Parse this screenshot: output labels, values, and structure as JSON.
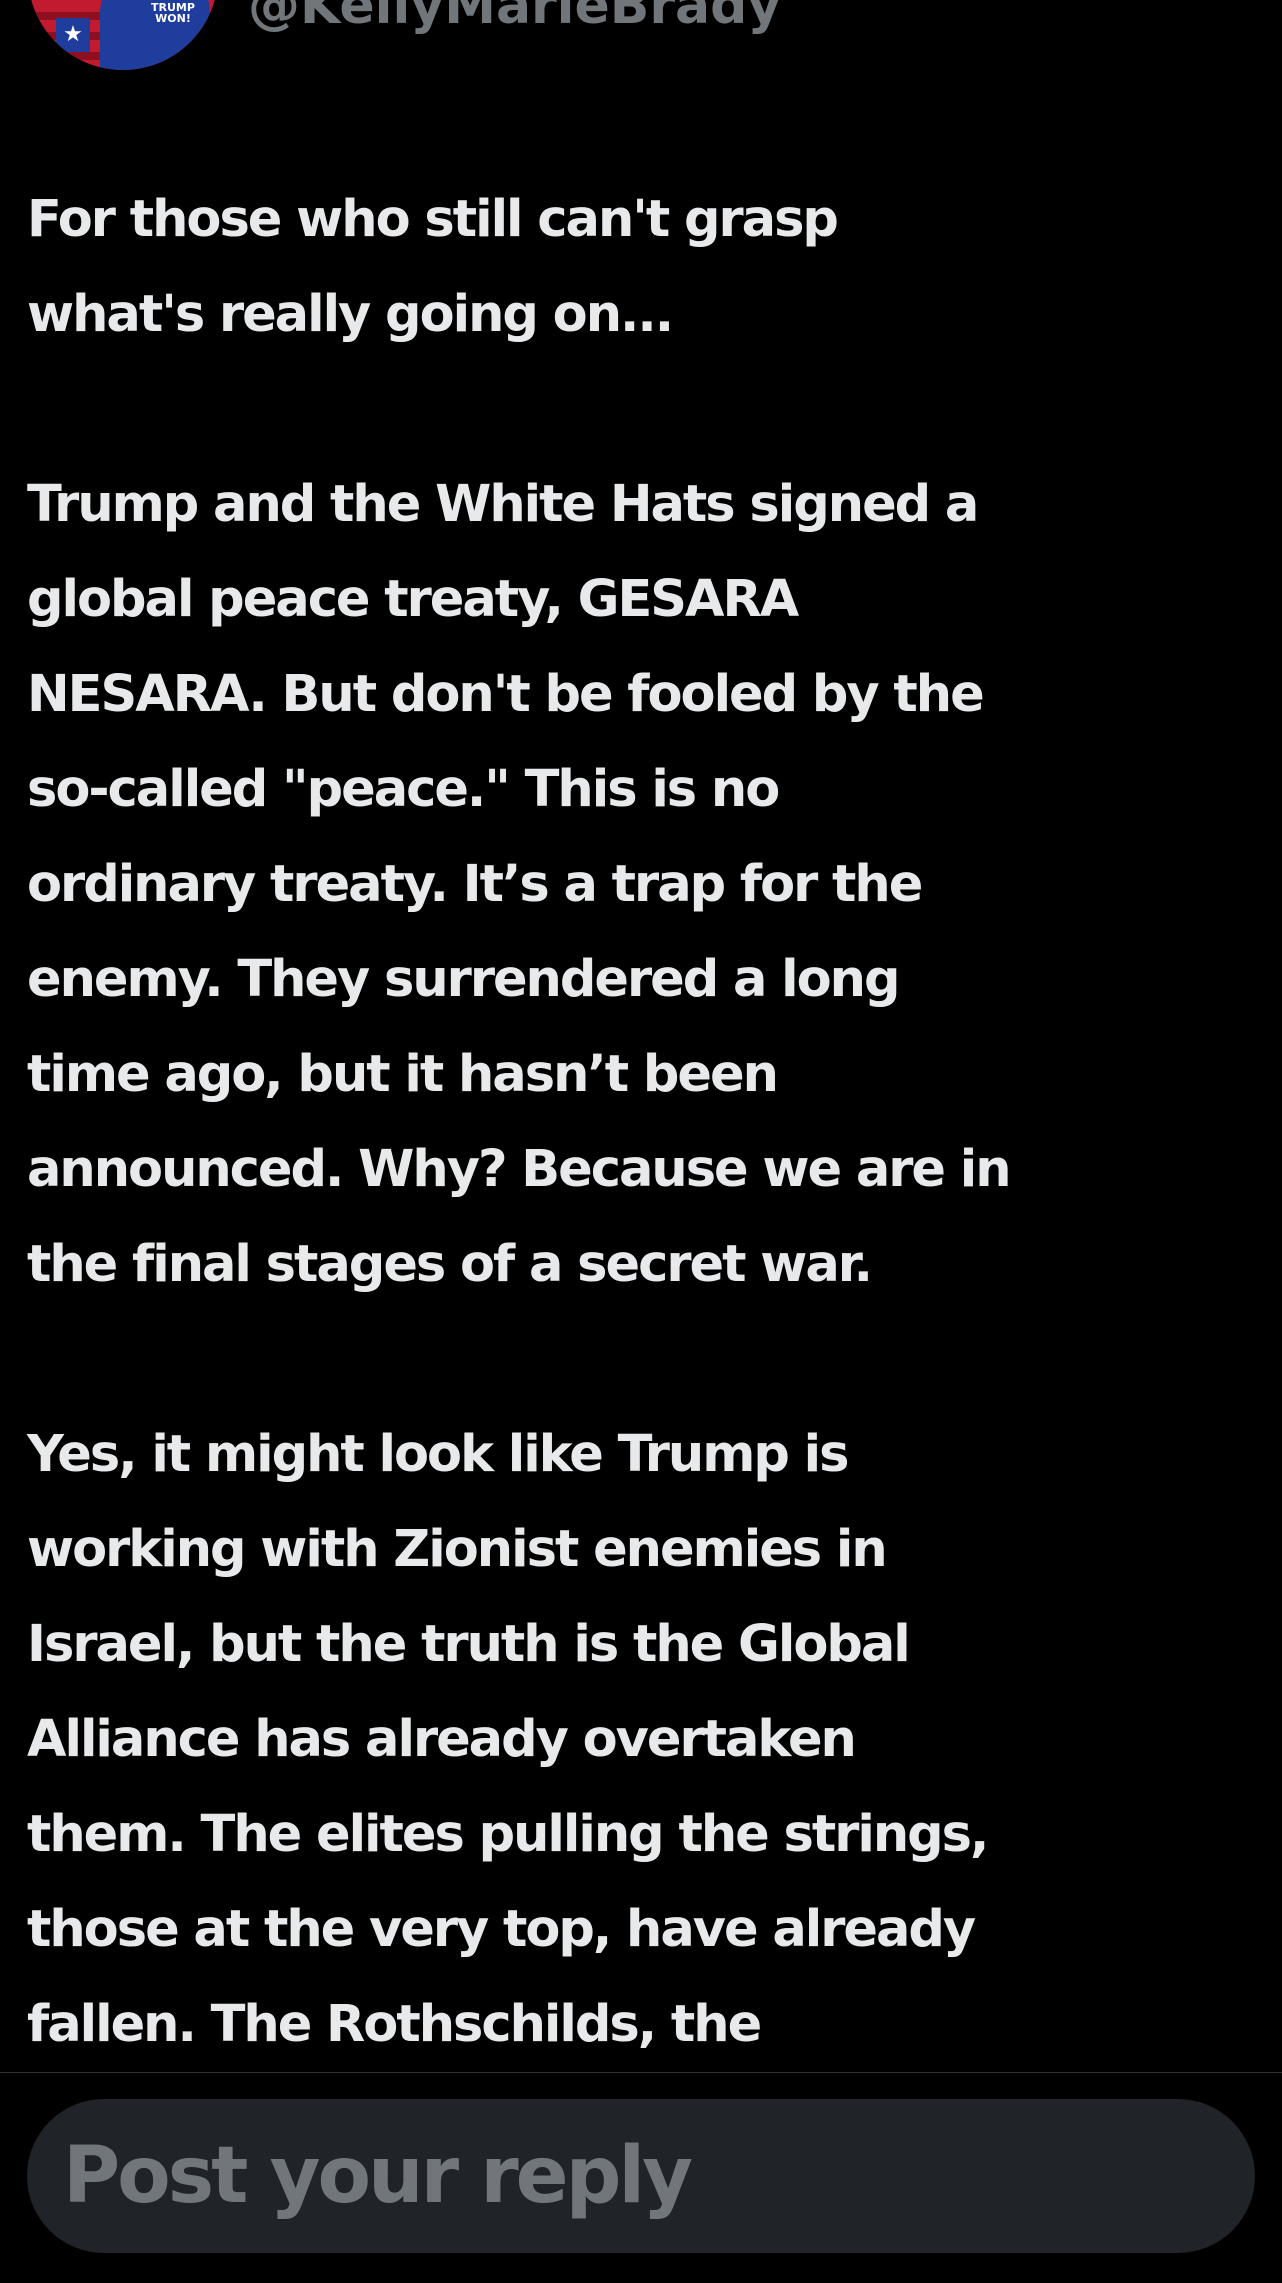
{
  "profile": {
    "avatar_text": "TRUMP WON!",
    "handle": "@KellyMarieBrady"
  },
  "tweet": {
    "text": "For those who still can't grasp\nwhat's really going on...\n\nTrump and the White Hats signed a\nglobal peace treaty, GESARA\nNESARA. But don't be fooled by the\nso-called \"peace.\" This is no\nordinary treaty. It’s a trap for the\nenemy. They surrendered a long\ntime ago, but it hasn’t been\nannounced. Why? Because we are in\nthe final stages of a secret war.\n\nYes, it might look like Trump is\nworking with Zionist enemies in\nIsrael, but the truth is the Global\nAlliance has already overtaken\nthem. The elites pulling the strings,\nthose at the very top, have already\nfallen. The Rothschilds, the"
  },
  "reply": {
    "placeholder": "Post your reply"
  },
  "colors": {
    "background": "#000000",
    "text": "#e7e9ea",
    "muted": "#71767b",
    "input_bg": "#202327"
  }
}
